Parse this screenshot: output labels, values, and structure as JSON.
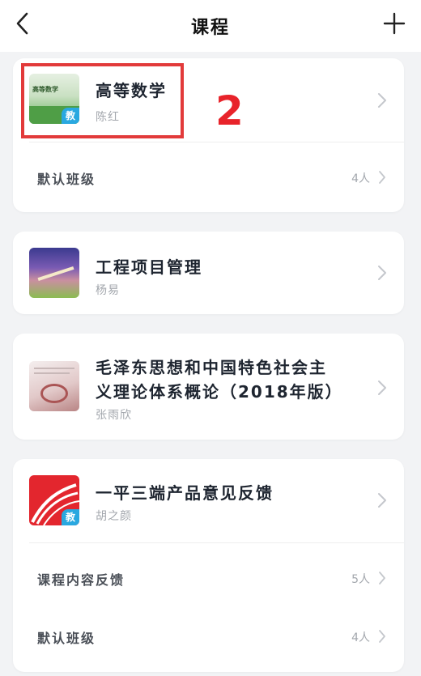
{
  "header": {
    "title": "课程"
  },
  "courses": [
    {
      "name": "高等数学",
      "teacher": "陈红",
      "thumb_badge": "教",
      "thumb_caption": "高等数学",
      "classes": [
        {
          "label": "默认班级",
          "count": "4人"
        }
      ]
    },
    {
      "name": "工程项目管理",
      "teacher": "杨易",
      "classes": []
    },
    {
      "name_line1": "毛泽东思想和中国特色社会主",
      "name_line2": "义理论体系概论（2018年版）",
      "teacher": "张雨欣",
      "classes": []
    },
    {
      "name": "一平三端产品意见反馈",
      "teacher": "胡之颜",
      "thumb_badge": "教",
      "classes": [
        {
          "label": "课程内容反馈",
          "count": "5人"
        },
        {
          "label": "默认班级",
          "count": "4人"
        }
      ]
    }
  ],
  "annotation": {
    "label": "2",
    "color": "#e8232a"
  },
  "colors": {
    "background": "#f2f3f5",
    "card": "#ffffff",
    "title_text": "#1e2530",
    "muted_text": "#a3a7ad",
    "highlight_border": "#e23a3a",
    "badge_blue": "#29a8e0"
  },
  "icons": {
    "back": "chevron-left-icon",
    "add": "plus-icon",
    "row_arrow": "chevron-right-icon"
  }
}
